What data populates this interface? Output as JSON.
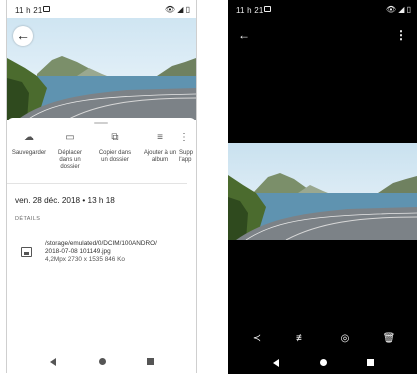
{
  "left_screen": {
    "status": {
      "time": "11 h 21"
    },
    "actions": [
      {
        "label": "Sauvegarder"
      },
      {
        "label": "Déplacer dans un dossier"
      },
      {
        "label": "Copier dans un dossier"
      },
      {
        "label": "Ajouter à un album"
      },
      {
        "label": "Supp l'app"
      }
    ],
    "datetime": "ven. 28 déc. 2018 • 13 h 18",
    "details_label": "DÉTAILS",
    "file": {
      "path": "/storage/emulated/0/DCIM/100ANDRO/",
      "name": "2018-07-08 101149.jpg",
      "meta": "4,2Mpx  2730 x 1535  846 Ko"
    }
  },
  "right_screen": {
    "status": {
      "time": "11 h 21"
    }
  },
  "icons": {
    "left": [
      "back-arrow-icon",
      "cloud-upload-icon",
      "folder-move-icon",
      "copy-folder-icon",
      "playlist-add-icon",
      "image-file-icon"
    ],
    "right": [
      "back-arrow-icon",
      "more-vert-icon",
      "share-icon",
      "tune-icon",
      "lens-icon",
      "delete-icon"
    ]
  },
  "colors": {
    "dark_background": "#000000",
    "light_background": "#ffffff",
    "icon_gray": "#555555"
  }
}
